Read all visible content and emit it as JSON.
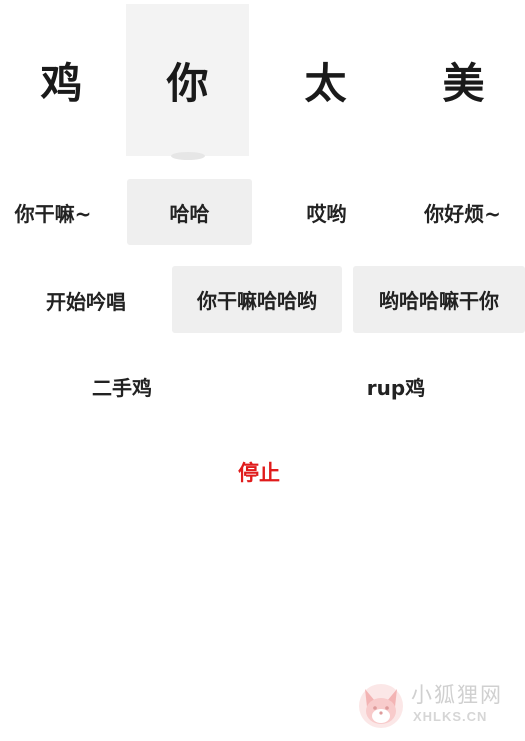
{
  "big_row": [
    {
      "label": "鸡"
    },
    {
      "label": "你"
    },
    {
      "label": "太"
    },
    {
      "label": "美"
    }
  ],
  "row1": [
    {
      "label": "你干嘛~"
    },
    {
      "label": "哈哈"
    },
    {
      "label": "哎哟"
    },
    {
      "label": "你好烦~"
    }
  ],
  "row2": [
    {
      "label": "开始吟唱"
    },
    {
      "label": "你干嘛哈哈哟"
    },
    {
      "label": "哟哈哈嘛干你"
    }
  ],
  "row3": [
    {
      "label": "二手鸡"
    },
    {
      "label": "rup鸡"
    }
  ],
  "stop_label": "停止",
  "watermark": {
    "title": "小狐狸网",
    "subtitle": "XHLKS.CN"
  },
  "colors": {
    "stop": "#e01b1b",
    "shaded": "#efefef",
    "pressed": "#f3f3f3"
  }
}
